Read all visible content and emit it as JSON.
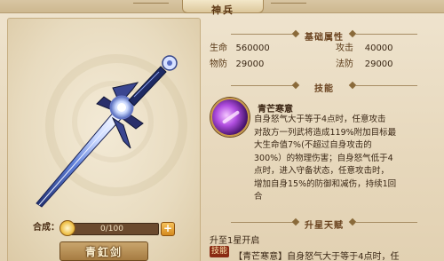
{
  "header": {
    "title": "神兵"
  },
  "weapon": {
    "name": "青釭剑",
    "compose_label": "合成：",
    "compose_count": "0/100",
    "compose_progress": 0,
    "add_label": "+"
  },
  "attributes": {
    "heading": "基础属性",
    "hp_label": "生命",
    "hp_value": "560000",
    "atk_label": "攻击",
    "atk_value": "40000",
    "pdef_label": "物防",
    "pdef_value": "29000",
    "mdef_label": "法防",
    "mdef_value": "29000"
  },
  "skill": {
    "heading": "技能",
    "name": "青芒寒意",
    "lines": [
      "自身怒气大于等于4点时，任意攻击",
      "对敌方一列武将造成119%附加目标最",
      "大生命值7%(不超过自身攻击的",
      "300%）的物理伤害；自身怒气低于4",
      "点时，进入守备状态，任意攻击时，",
      "增加自身15%的防御和减伤，持续1回",
      "合"
    ]
  },
  "star": {
    "heading": "升星天赋",
    "unlock_text": "升至1星开启",
    "tag": "技能",
    "talent_text": "【青芒寒意】自身怒气大于等于4点时，任"
  },
  "colors": {
    "accent": "#8a2b14",
    "gold": "#d8b25a",
    "text": "#3b2816"
  }
}
